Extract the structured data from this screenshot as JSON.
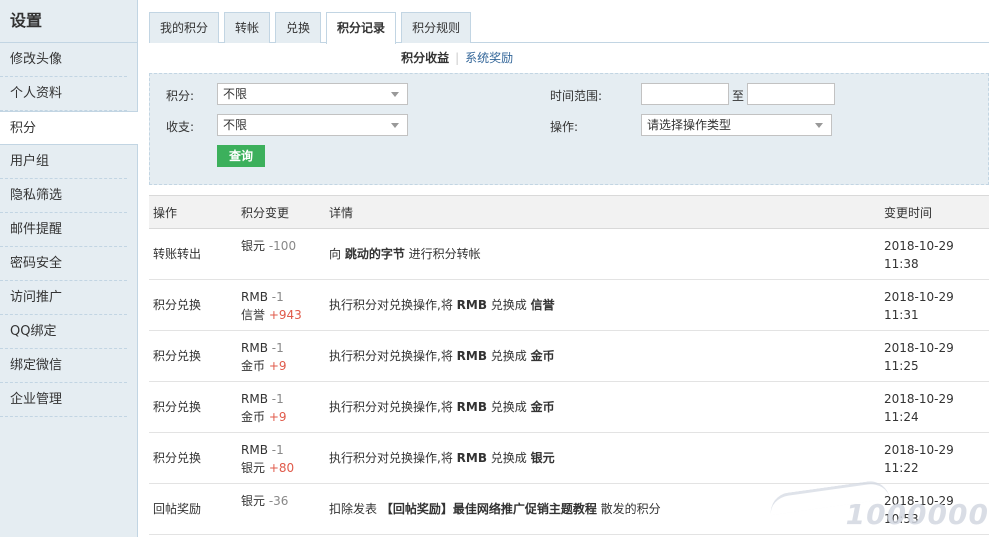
{
  "sidebar": {
    "title": "设置",
    "items": [
      {
        "label": "修改头像",
        "active": false
      },
      {
        "label": "个人资料",
        "active": false
      },
      {
        "label": "积分",
        "active": true
      },
      {
        "label": "用户组",
        "active": false
      },
      {
        "label": "隐私筛选",
        "active": false
      },
      {
        "label": "邮件提醒",
        "active": false
      },
      {
        "label": "密码安全",
        "active": false
      },
      {
        "label": "访问推广",
        "active": false
      },
      {
        "label": "QQ绑定",
        "active": false
      },
      {
        "label": "绑定微信",
        "active": false
      },
      {
        "label": "企业管理",
        "active": false
      }
    ]
  },
  "tabs": [
    {
      "label": "我的积分",
      "active": false
    },
    {
      "label": "转帐",
      "active": false
    },
    {
      "label": "兑换",
      "active": false
    },
    {
      "label": "积分记录",
      "active": true
    },
    {
      "label": "积分规则",
      "active": false
    }
  ],
  "subnav": {
    "active": "积分收益",
    "link": "系统奖励",
    "sep": "|"
  },
  "filter": {
    "credit_label": "积分:",
    "credit_value": "不限",
    "inout_label": "收支:",
    "inout_value": "不限",
    "time_label": "时间范围:",
    "time_to": "至",
    "op_label": "操作:",
    "op_value": "请选择操作类型",
    "query_button": "查询"
  },
  "table": {
    "headers": {
      "op": "操作",
      "change": "积分变更",
      "detail": "详情",
      "time": "变更时间"
    },
    "rows": [
      {
        "op": "转账转出",
        "changes": [
          {
            "unit": "银元",
            "delta": "-100",
            "sign": "neg"
          }
        ],
        "detail": [
          {
            "t": "向 ",
            "b": false
          },
          {
            "t": "跳动的字节",
            "b": true
          },
          {
            "t": " 进行积分转帐",
            "b": false
          }
        ],
        "date": "2018-10-29",
        "time": "11:38"
      },
      {
        "op": "积分兑换",
        "changes": [
          {
            "unit": "RMB",
            "delta": "-1",
            "sign": "neg"
          },
          {
            "unit": "信誉",
            "delta": "+943",
            "sign": "pos"
          }
        ],
        "detail": [
          {
            "t": "执行积分对兑换操作,将 ",
            "b": false
          },
          {
            "t": "RMB",
            "b": true
          },
          {
            "t": " 兑换成 ",
            "b": false
          },
          {
            "t": "信誉",
            "b": true
          }
        ],
        "date": "2018-10-29",
        "time": "11:31"
      },
      {
        "op": "积分兑换",
        "changes": [
          {
            "unit": "RMB",
            "delta": "-1",
            "sign": "neg"
          },
          {
            "unit": "金币",
            "delta": "+9",
            "sign": "pos"
          }
        ],
        "detail": [
          {
            "t": "执行积分对兑换操作,将 ",
            "b": false
          },
          {
            "t": "RMB",
            "b": true
          },
          {
            "t": " 兑换成 ",
            "b": false
          },
          {
            "t": "金币",
            "b": true
          }
        ],
        "date": "2018-10-29",
        "time": "11:25"
      },
      {
        "op": "积分兑换",
        "changes": [
          {
            "unit": "RMB",
            "delta": "-1",
            "sign": "neg"
          },
          {
            "unit": "金币",
            "delta": "+9",
            "sign": "pos"
          }
        ],
        "detail": [
          {
            "t": "执行积分对兑换操作,将 ",
            "b": false
          },
          {
            "t": "RMB",
            "b": true
          },
          {
            "t": " 兑换成 ",
            "b": false
          },
          {
            "t": "金币",
            "b": true
          }
        ],
        "date": "2018-10-29",
        "time": "11:24"
      },
      {
        "op": "积分兑换",
        "changes": [
          {
            "unit": "RMB",
            "delta": "-1",
            "sign": "neg"
          },
          {
            "unit": "银元",
            "delta": "+80",
            "sign": "pos"
          }
        ],
        "detail": [
          {
            "t": "执行积分对兑换操作,将 ",
            "b": false
          },
          {
            "t": "RMB",
            "b": true
          },
          {
            "t": " 兑换成 ",
            "b": false
          },
          {
            "t": "银元",
            "b": true
          }
        ],
        "date": "2018-10-29",
        "time": "11:22"
      },
      {
        "op": "回帖奖励",
        "changes": [
          {
            "unit": "银元",
            "delta": "-36",
            "sign": "neg"
          }
        ],
        "detail": [
          {
            "t": "扣除发表 ",
            "b": false
          },
          {
            "t": "【回帖奖励】最佳网络推广促销主题教程",
            "b": true
          },
          {
            "t": " 散发的积分",
            "b": false
          }
        ],
        "date": "2018-10-29",
        "time": "10:53"
      }
    ]
  },
  "watermark": "1000000"
}
